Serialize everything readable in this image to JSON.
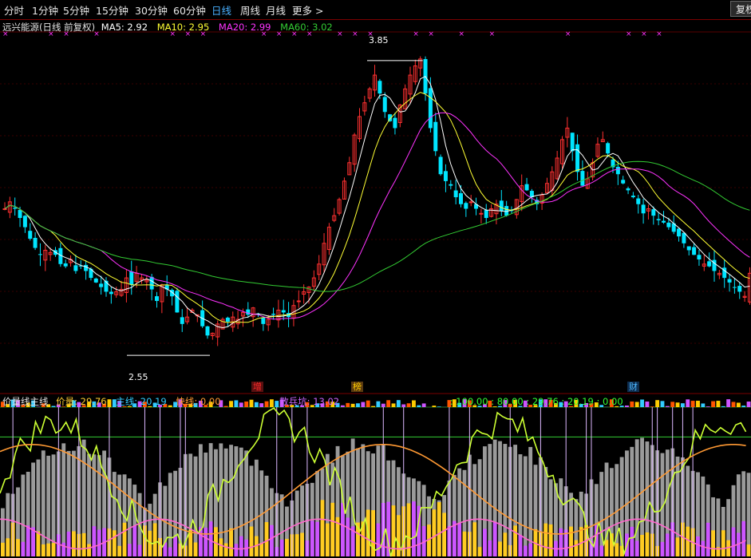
{
  "tabs": [
    {
      "label": "分时",
      "active": false
    },
    {
      "label": "1分钟",
      "active": false
    },
    {
      "label": "5分钟",
      "active": false
    },
    {
      "label": "15分钟",
      "active": false
    },
    {
      "label": "30分钟",
      "active": false
    },
    {
      "label": "60分钟",
      "active": false
    },
    {
      "label": "日线",
      "active": true
    },
    {
      "label": "周线",
      "active": false
    },
    {
      "label": "月线",
      "active": false
    },
    {
      "label": "更多 >",
      "active": false
    }
  ],
  "restore_button": "复权",
  "main_legend": {
    "title": "远兴能源(日线 前复权)",
    "ma5": "MA5: 2.92",
    "ma10": "MA10: 2.95",
    "ma20": "MA20: 2.99",
    "ma60": "MA60: 3.02"
  },
  "annotations": {
    "high": "3.85",
    "low": "2.55"
  },
  "events": [
    {
      "label": "增",
      "color": "#ff2a2a"
    },
    {
      "label": "榜",
      "color": "#ffcc00"
    },
    {
      "label": "财",
      "color": "#4db8ff"
    }
  ],
  "sub_legend": {
    "name": "价量线主线",
    "price_vol": "价量: 29.76",
    "main_line": "主线: 20.19",
    "fast_line": "快线: 0.00",
    "retail": "散兵坑: 13.02",
    "levels": ": 100.00 : 80.00 : 29.76 : 20.19 : 0.00"
  },
  "colors": {
    "up": "#ff3030",
    "down": "#00e5ff",
    "ma5": "#ffffff",
    "ma10": "#ffff33",
    "ma20": "#ff33ff",
    "ma60": "#33cc33"
  },
  "chart_data": {
    "type": "candlestick",
    "symbol": "远兴能源",
    "high": 3.85,
    "low": 2.55,
    "close_series": [
      3.2,
      3.23,
      3.2,
      3.16,
      3.12,
      3.07,
      3.03,
      3.0,
      3.02,
      3.01,
      3.0,
      2.96,
      2.95,
      2.98,
      2.93,
      2.95,
      2.93,
      2.9,
      2.88,
      2.86,
      2.84,
      2.83,
      2.84,
      2.85,
      2.9,
      2.87,
      2.92,
      2.9,
      2.89,
      2.85,
      2.8,
      2.87,
      2.85,
      2.82,
      2.75,
      2.7,
      2.73,
      2.76,
      2.74,
      2.69,
      2.65,
      2.66,
      2.7,
      2.72,
      2.71,
      2.73,
      2.72,
      2.75,
      2.74,
      2.77,
      2.74,
      2.7,
      2.72,
      2.74,
      2.76,
      2.75,
      2.73,
      2.78,
      2.8,
      2.84,
      2.86,
      2.9,
      2.96,
      3.05,
      3.12,
      3.17,
      3.24,
      3.32,
      3.4,
      3.52,
      3.6,
      3.66,
      3.72,
      3.78,
      3.7,
      3.62,
      3.58,
      3.55,
      3.65,
      3.72,
      3.78,
      3.82,
      3.85,
      3.7,
      3.55,
      3.45,
      3.35,
      3.32,
      3.3,
      3.25,
      3.22,
      3.2,
      3.23,
      3.2,
      3.18,
      3.16,
      3.2,
      3.22,
      3.19,
      3.17,
      3.19,
      3.24,
      3.3,
      3.28,
      3.25,
      3.22,
      3.26,
      3.31,
      3.36,
      3.42,
      3.5,
      3.55,
      3.45,
      3.36,
      3.3,
      3.33,
      3.4,
      3.48,
      3.5,
      3.44,
      3.38,
      3.35,
      3.31,
      3.28,
      3.25,
      3.22,
      3.18,
      3.2,
      3.17,
      3.15,
      3.14,
      3.12,
      3.1,
      3.08,
      3.05,
      3.02,
      3.0,
      2.98,
      2.96,
      2.95,
      2.93,
      2.92,
      2.9,
      2.88,
      2.86,
      2.84,
      2.82,
      2.92
    ]
  }
}
